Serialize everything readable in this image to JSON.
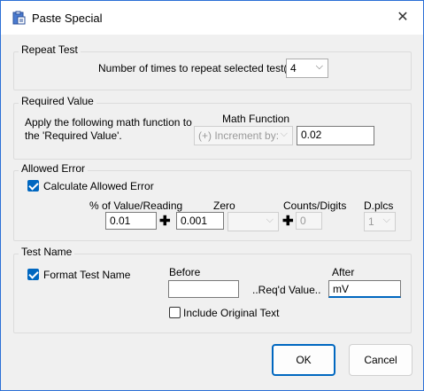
{
  "window": {
    "title": "Paste Special",
    "icon": "clipboard-icon",
    "close_glyph": "✕"
  },
  "repeat_test": {
    "legend": "Repeat Test",
    "label": "Number of times to repeat selected test(s):",
    "value": "4"
  },
  "required_value": {
    "legend": "Required Value",
    "description_line1": "Apply the following math function to",
    "description_line2": "the 'Required Value'.",
    "math_function_label": "Math Function",
    "math_function_value": "(+) Increment by:",
    "value": "0.02"
  },
  "allowed_error": {
    "legend": "Allowed Error",
    "calculate_label": "Calculate Allowed Error",
    "calculate_checked": true,
    "pct_label": "% of Value/Reading",
    "pct_value": "0.01",
    "zero_label": "Zero",
    "zero_value": "0.001",
    "zero_unit_value": "",
    "counts_label": "Counts/Digits",
    "counts_value": "0",
    "dplcs_label": "D.plcs",
    "dplcs_value": "1",
    "plus_glyph": "✚"
  },
  "test_name": {
    "legend": "Test Name",
    "format_label": "Format Test Name",
    "format_checked": true,
    "before_label": "Before",
    "before_value": "",
    "middle_text": "..Req'd Value..",
    "after_label": "After",
    "after_value": "mV",
    "include_original_label": "Include Original Text",
    "include_original_checked": false
  },
  "buttons": {
    "ok_label": "OK",
    "cancel_label": "Cancel"
  },
  "colors": {
    "accent": "#0067c0",
    "frame": "#2b6fd6"
  }
}
